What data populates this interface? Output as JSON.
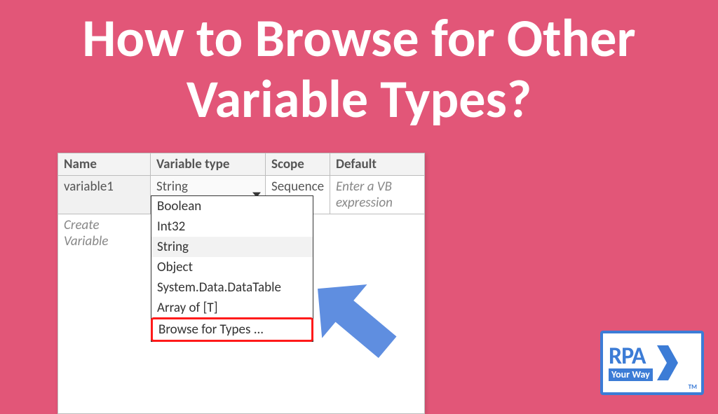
{
  "title": "How to Browse for Other Variable Types?",
  "table": {
    "headers": {
      "name": "Name",
      "type": "Variable type",
      "scope": "Scope",
      "default": "Default"
    },
    "row": {
      "name": "variable1",
      "type": "String",
      "scope": "Sequence",
      "default": "Enter a VB expression"
    },
    "create": "Create Variable"
  },
  "dropdown": {
    "items": [
      "Boolean",
      "Int32",
      "String",
      "Object",
      "System.Data.DataTable",
      "Array of [T]",
      "Browse for Types ..."
    ]
  },
  "logo": {
    "line1": "RPA",
    "line2": "Your Way",
    "tm": "TM"
  }
}
